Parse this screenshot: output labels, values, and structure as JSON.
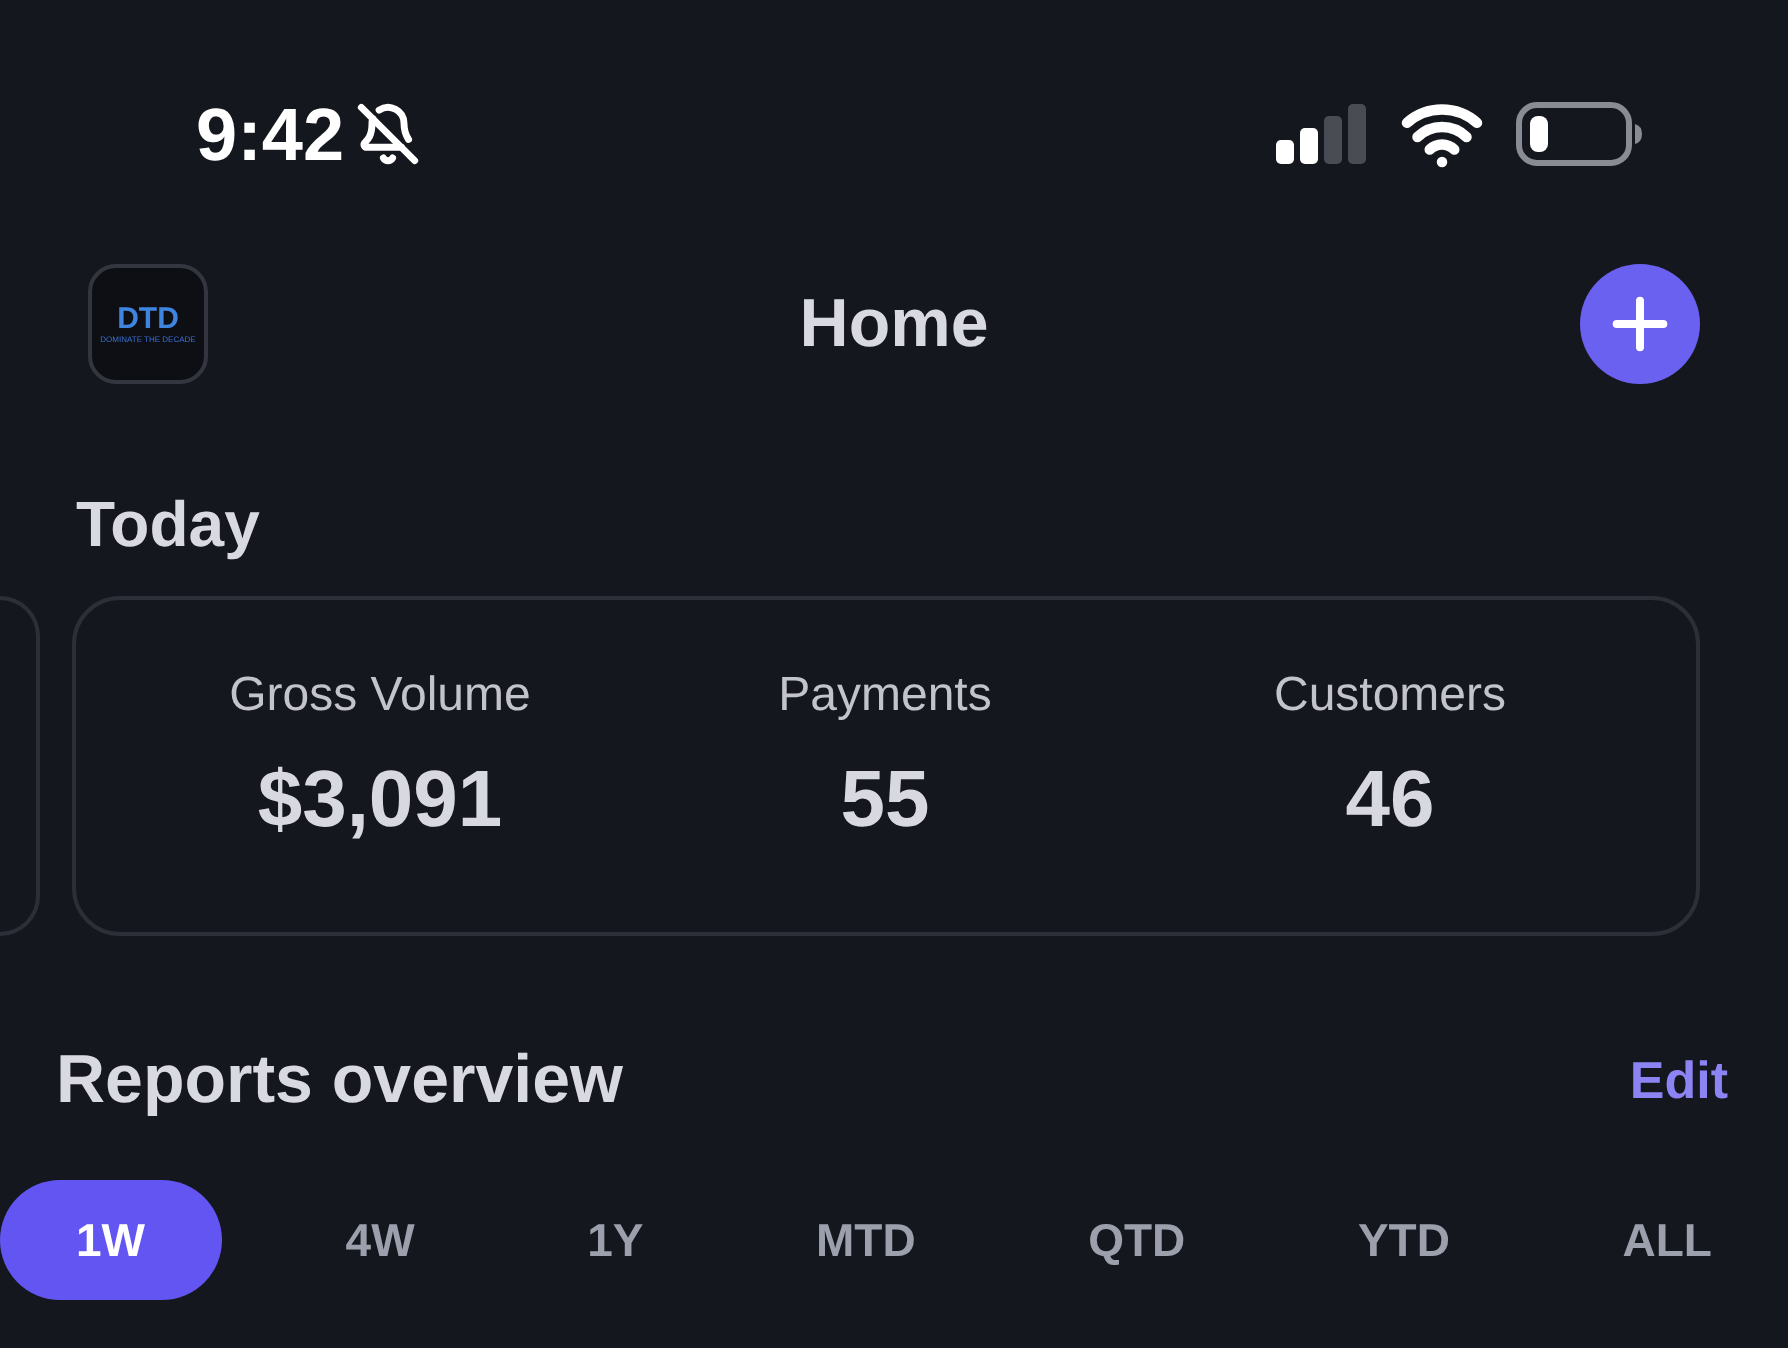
{
  "status_bar": {
    "time": "9:42"
  },
  "header": {
    "title": "Home",
    "logo": {
      "mark": "DTD",
      "tagline": "DOMINATE THE DECADE"
    }
  },
  "today": {
    "title": "Today",
    "stats": [
      {
        "label": "Gross Volume",
        "value": "$3,091"
      },
      {
        "label": "Payments",
        "value": "55"
      },
      {
        "label": "Customers",
        "value": "46"
      }
    ]
  },
  "reports": {
    "title": "Reports overview",
    "action": "Edit",
    "ranges": [
      {
        "label": "1W",
        "selected": true
      },
      {
        "label": "4W",
        "selected": false
      },
      {
        "label": "1Y",
        "selected": false
      },
      {
        "label": "MTD",
        "selected": false
      },
      {
        "label": "QTD",
        "selected": false
      },
      {
        "label": "YTD",
        "selected": false
      },
      {
        "label": "ALL",
        "selected": false
      }
    ]
  }
}
